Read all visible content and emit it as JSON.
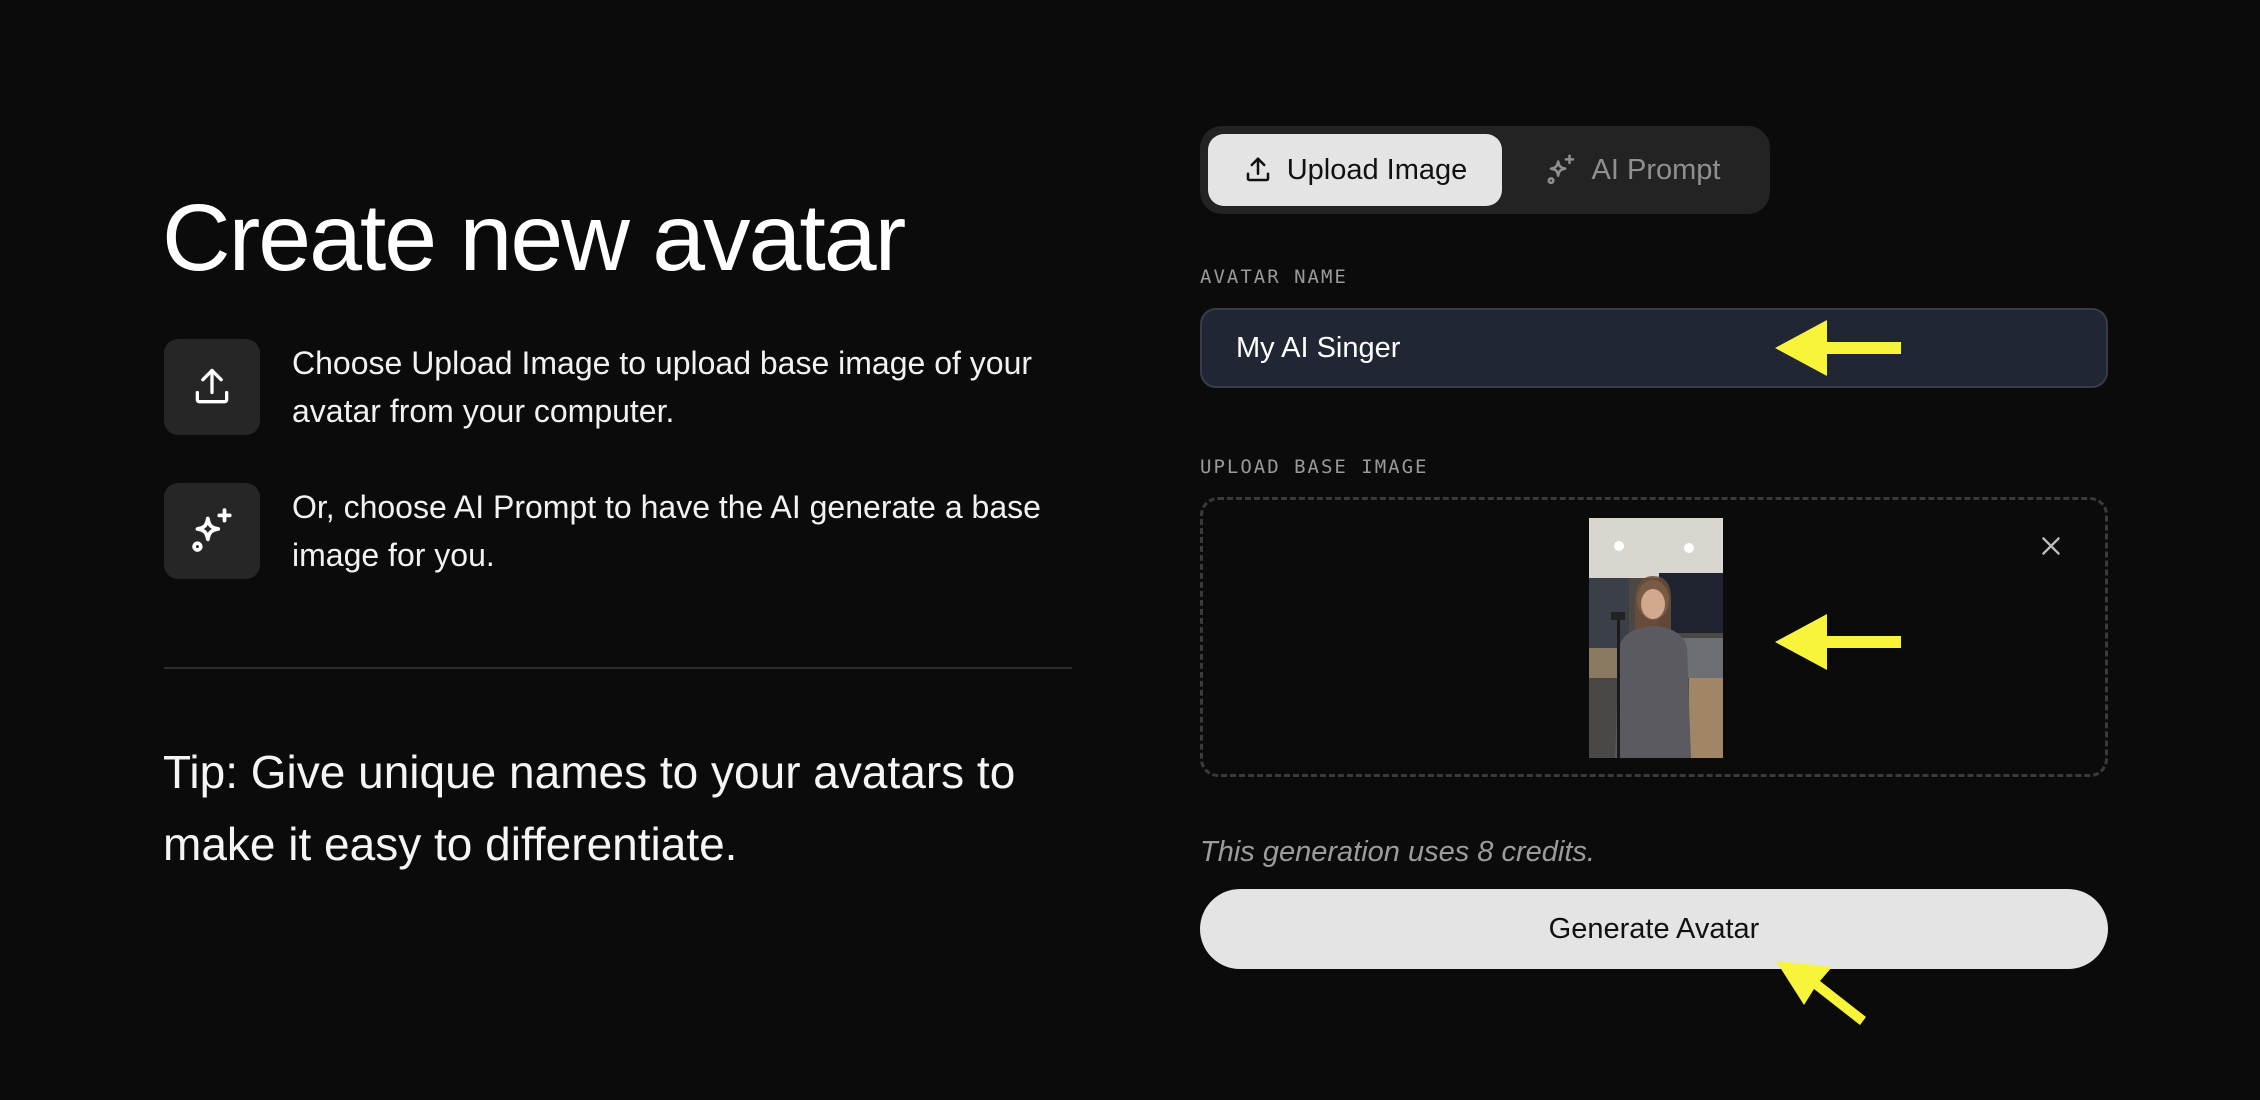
{
  "header": {
    "title": "Create new avatar"
  },
  "steps": [
    {
      "icon": "upload-icon",
      "text": "Choose Upload Image to upload base image of your avatar from your computer."
    },
    {
      "icon": "sparkles-icon",
      "text": "Or, choose AI Prompt to have the AI generate a base image for you."
    }
  ],
  "tip": "Tip: Give unique names to your avatars to make it easy to differentiate.",
  "tabs": [
    {
      "label": "Upload Image",
      "icon": "upload-icon",
      "active": true
    },
    {
      "label": "AI Prompt",
      "icon": "sparkles-icon",
      "active": false
    }
  ],
  "form": {
    "name_label": "AVATAR NAME",
    "name_value": "My AI Singer",
    "upload_label": "UPLOAD BASE IMAGE",
    "credits_text": "This generation uses 8 credits.",
    "generate_label": "Generate Avatar"
  },
  "colors": {
    "background": "#0b0b0b",
    "input_bg": "#202633",
    "button_bg": "#e4e4e4",
    "annotation_arrow": "#f7f43a"
  }
}
